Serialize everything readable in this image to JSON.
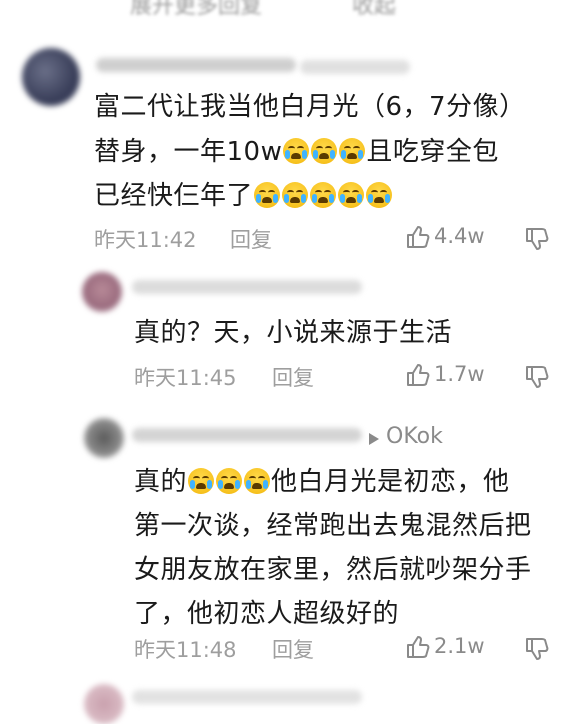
{
  "top_partial": {
    "left": "展开更多回复",
    "right": "收起"
  },
  "comments": [
    {
      "lines": [
        [
          "富二代让我当他白月光（6，7分像）"
        ],
        [
          "替身，一年10w",
          "cry",
          "cry",
          "cry",
          "且吃穿全包"
        ],
        [
          "已经快仨年了",
          "cry",
          "cry",
          "cry",
          "cry",
          "cry"
        ]
      ],
      "time": "昨天11:42",
      "reply": "回复",
      "likes": "4.4w"
    },
    {
      "lines": [
        [
          "真的？天，小说来源于生活"
        ]
      ],
      "time": "昨天11:45",
      "reply": "回复",
      "likes": "1.7w"
    },
    {
      "reply_to": "OKok",
      "lines": [
        [
          "真的",
          "cry",
          "cry",
          "cry",
          "他白月光是初恋，他"
        ],
        [
          "第一次谈，经常跑出去鬼混然后把"
        ],
        [
          "女朋友放在家里，然后就吵架分手"
        ],
        [
          "了，他初恋人超级好的"
        ]
      ],
      "time": "昨天11:48",
      "reply": "回复",
      "likes": "2.1w"
    }
  ],
  "icons": {
    "like": "thumbs-up-icon",
    "dislike": "thumbs-down-icon",
    "reply_arrow": "triangle-right-icon",
    "weibo": "weibo-logo-icon",
    "cry": "loudly-crying-face-emoji"
  },
  "colors": {
    "text": "#1a1a1a",
    "meta": "#9e9e9e",
    "background": "#ffffff"
  }
}
